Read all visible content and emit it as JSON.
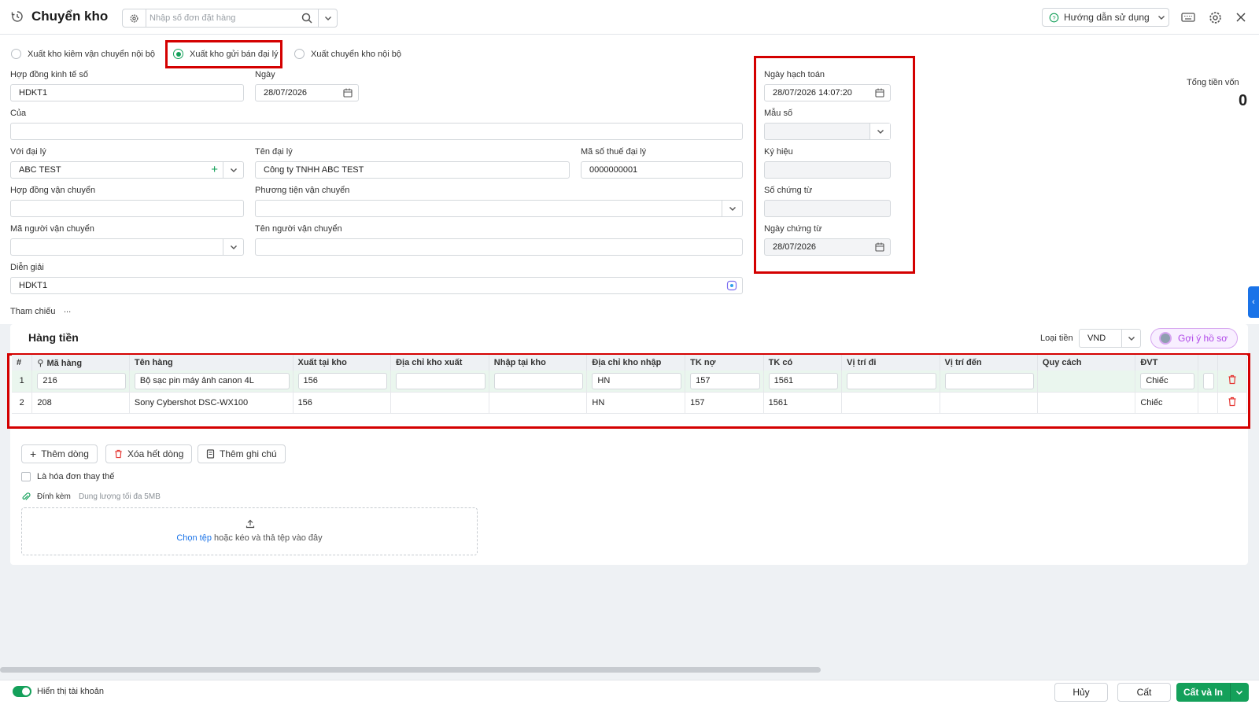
{
  "header": {
    "title": "Chuyển kho",
    "search_placeholder": "Nhập số đơn đặt hàng",
    "help_label": "Hướng dẫn sử dụng",
    "icons": [
      "history-icon",
      "gear-icon",
      "search-icon",
      "chevron-down-icon",
      "help-circle-icon",
      "keyboard-icon",
      "settings-icon",
      "close-icon"
    ]
  },
  "form": {
    "radios": [
      {
        "label": "Xuất kho kiêm vận chuyển nội bộ",
        "selected": false
      },
      {
        "label": "Xuất kho gửi bán đại lý",
        "selected": true
      },
      {
        "label": "Xuất chuyển kho nội bộ",
        "selected": false
      }
    ],
    "contract_label": "Hợp đồng kinh tế số",
    "contract_value": "HDKT1",
    "date_label": "Ngày",
    "date_value": "28/07/2026",
    "of_label": "Của",
    "of_value": "",
    "agent_label": "Với đại lý",
    "agent_value": "ABC TEST",
    "agent_name_label": "Tên đại lý",
    "agent_name_value": "Công ty TNHH ABC TEST",
    "tax_label": "Mã số thuế đại lý",
    "tax_value": "0000000001",
    "transport_contract_label": "Hợp đồng vận chuyển",
    "transport_contract_value": "",
    "vehicle_label": "Phương tiện vận chuyển",
    "vehicle_value": "",
    "carrier_code_label": "Mã người vận chuyển",
    "carrier_code_value": "",
    "carrier_name_label": "Tên người vận chuyển",
    "carrier_name_value": "",
    "desc_label": "Diễn giải",
    "desc_value": "HDKT1",
    "ref_label": "Tham chiếu",
    "ref_value": "..."
  },
  "voucher": {
    "accounting_date_label": "Ngày hạch toán",
    "accounting_date_value": "28/07/2026 14:07:20",
    "template_label": "Mẫu số",
    "template_value": "",
    "symbol_label": "Ký hiệu",
    "symbol_value": "",
    "number_label": "Số chứng từ",
    "number_value": "",
    "voucher_date_label": "Ngày chứng từ",
    "voucher_date_value": "28/07/2026"
  },
  "total": {
    "label": "Tổng tiền vốn",
    "value": "0"
  },
  "grid": {
    "title": "Hàng tiền",
    "currency_label": "Loại tiền",
    "currency_value": "VND",
    "suggest_label": "Gợi ý hồ sơ",
    "columns": [
      "#",
      "Mã hàng",
      "Tên hàng",
      "Xuất tại kho",
      "Địa chỉ kho xuất",
      "Nhập tại kho",
      "Địa chỉ kho nhập",
      "TK nợ",
      "TK có",
      "Vị trí đi",
      "Vị trí đến",
      "Quy cách",
      "ĐVT"
    ],
    "rows": [
      {
        "no": "1",
        "code": "216",
        "name": "Bộ sạc pin máy ảnh canon 4L",
        "out_wh": "156",
        "out_addr": "",
        "in_wh": "",
        "in_addr": "HN",
        "debit": "157",
        "credit": "1561",
        "from": "",
        "to": "",
        "spec": "",
        "unit": "Chiếc"
      },
      {
        "no": "2",
        "code": "208",
        "name": "Sony Cybershot DSC-WX100",
        "out_wh": "156",
        "out_addr": "",
        "in_wh": "",
        "in_addr": "HN",
        "debit": "157",
        "credit": "1561",
        "from": "",
        "to": "",
        "spec": "",
        "unit": "Chiếc"
      }
    ],
    "add_row": "Thêm dòng",
    "clear_rows": "Xóa hết dòng",
    "add_note": "Thêm ghi chú",
    "replace_invoice": "Là hóa đơn thay thế",
    "attach_label": "Đính kèm",
    "attach_hint": "Dung lượng tối đa 5MB",
    "upload_link": "Chọn tệp",
    "upload_text": "hoặc kéo và thả tệp vào đây"
  },
  "footer": {
    "show_account": "Hiển thị tài khoản",
    "cancel": "Hủy",
    "save": "Cất",
    "save_print": "Cất và In"
  },
  "colors": {
    "accent": "#14a05a",
    "highlight": "#d40000",
    "suggest": "#b048e8"
  }
}
